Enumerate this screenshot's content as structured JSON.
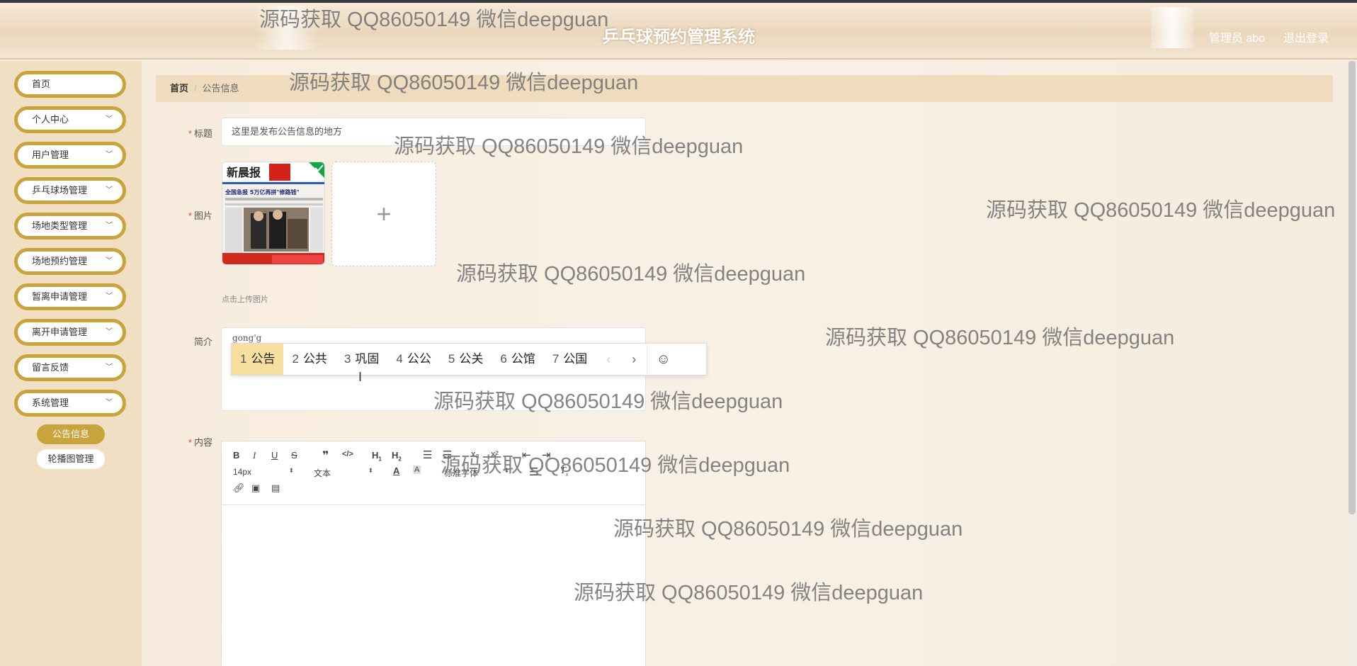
{
  "header": {
    "title": "乒乓球预约管理系统",
    "user": "管理员 abo",
    "logout": "退出登录"
  },
  "sidebar": {
    "items": [
      {
        "label": "首页",
        "chevron": false
      },
      {
        "label": "个人中心",
        "chevron": true
      },
      {
        "label": "用户管理",
        "chevron": true
      },
      {
        "label": "乒乓球场管理",
        "chevron": true
      },
      {
        "label": "场地类型管理",
        "chevron": true
      },
      {
        "label": "场地预约管理",
        "chevron": true
      },
      {
        "label": "暂离申请管理",
        "chevron": true
      },
      {
        "label": "离开申请管理",
        "chevron": true
      },
      {
        "label": "留言反馈",
        "chevron": true
      },
      {
        "label": "系统管理",
        "chevron": true
      }
    ],
    "sub_items": [
      {
        "label": "公告信息",
        "active": true
      },
      {
        "label": "轮播图管理",
        "active": false
      }
    ]
  },
  "breadcrumb": {
    "home": "首页",
    "separator": "/",
    "current": "公告信息"
  },
  "form": {
    "title_label": "标题",
    "title_value": "这里是发布公告信息的地方",
    "image_label": "图片",
    "upload_hint": "点击上传图片",
    "intro_label": "简介",
    "intro_typed": "gong'g",
    "content_label": "内容"
  },
  "ime": {
    "candidates": [
      {
        "num": "1",
        "text": "公告"
      },
      {
        "num": "2",
        "text": "公共"
      },
      {
        "num": "3",
        "text": "巩固"
      },
      {
        "num": "4",
        "text": "公公"
      },
      {
        "num": "5",
        "text": "公关"
      },
      {
        "num": "6",
        "text": "公馆"
      },
      {
        "num": "7",
        "text": "公国"
      }
    ],
    "prev": "‹",
    "next": "›",
    "emoji": "☺"
  },
  "editor": {
    "font_size": "14px",
    "paragraph": "文本",
    "font_family": "标准字体"
  },
  "thumbnail": {
    "paper_name": "新晨报",
    "headline": "全国急报 5万亿再拼\"修路钱\""
  },
  "watermark": "源码获取 QQ86050149 微信deepguan",
  "colors": {
    "accent": "#c9a33b",
    "sidebar_bg": "#f0dfc3",
    "breadcrumb_bg": "#efdcbe",
    "required": "#e74c3c",
    "ime_selected": "#f7dfa0"
  }
}
